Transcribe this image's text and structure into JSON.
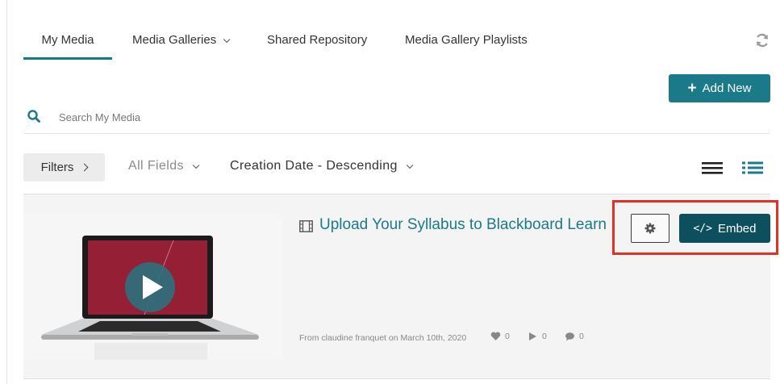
{
  "tabs": [
    {
      "label": "My Media",
      "active": true
    },
    {
      "label": "Media Galleries",
      "has_dropdown": true
    },
    {
      "label": "Shared Repository"
    },
    {
      "label": "Media Gallery Playlists"
    }
  ],
  "toolbar": {
    "refresh_icon": "refresh-icon",
    "add_new_label": "Add New"
  },
  "search": {
    "placeholder": "Search My Media",
    "value": ""
  },
  "filters": {
    "filters_label": "Filters",
    "fields_label": "All Fields",
    "sort_label": "Creation Date - Descending"
  },
  "views": [
    "list-view-icon",
    "detailed-view-icon"
  ],
  "entry": {
    "title": "Upload Your Syllabus to Blackboard Learn",
    "meta": "From claudine franquet on March 10th, 2020",
    "likes": "0",
    "plays": "0",
    "comments": "0",
    "embed_label": "Embed"
  },
  "colors": {
    "accent": "#1a7a8a",
    "embed": "#0d4f5c",
    "highlight": "#e53025"
  }
}
